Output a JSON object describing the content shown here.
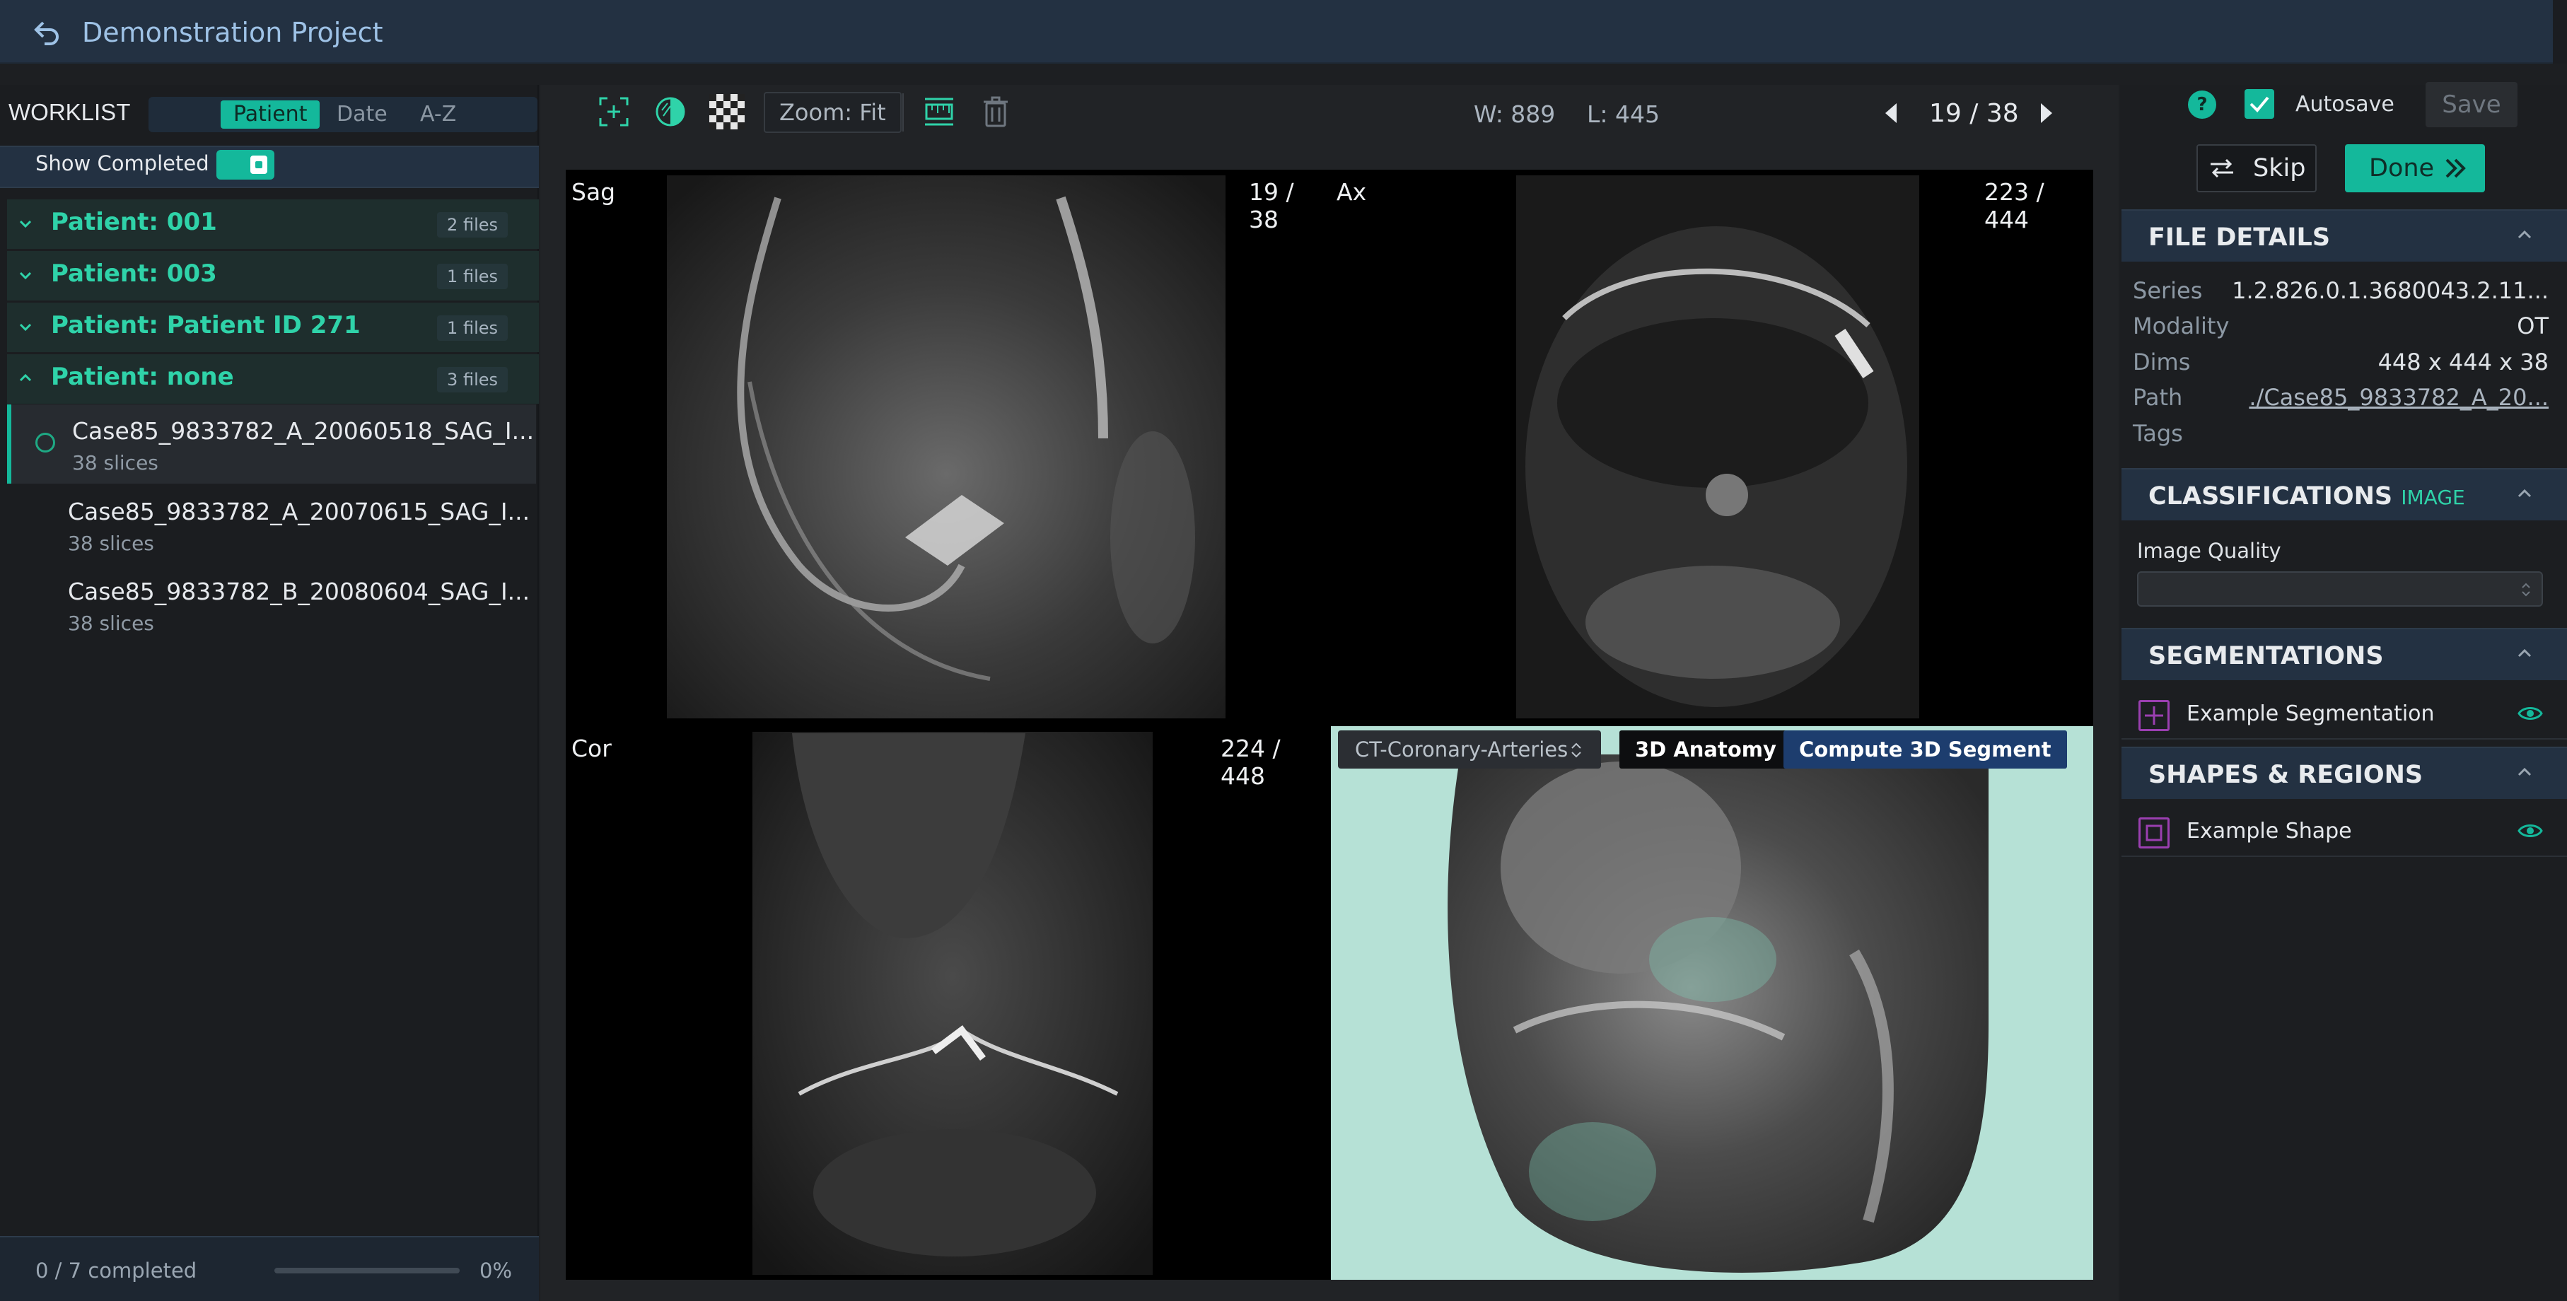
{
  "header": {
    "title": "Demonstration Project",
    "back_icon": "back-arrow-icon"
  },
  "worklist": {
    "title": "WORKLIST",
    "sort_options": [
      "Patient",
      "Date",
      "A-Z"
    ],
    "active_sort": "Patient",
    "show_completed_label": "Show Completed",
    "show_completed": true,
    "patients": [
      {
        "name": "Patient: 001",
        "count": "2 files",
        "expanded": false
      },
      {
        "name": "Patient: 003",
        "count": "1 files",
        "expanded": false
      },
      {
        "name": "Patient: Patient ID 271",
        "count": "1 files",
        "expanded": false
      },
      {
        "name": "Patient: none",
        "count": "3 files",
        "expanded": true
      }
    ],
    "files": [
      {
        "name": "Case85_9833782_A_20060518_SAG_I...",
        "slices": "38 slices",
        "selected": true
      },
      {
        "name": "Case85_9833782_A_20070615_SAG_I...",
        "slices": "38 slices",
        "selected": false
      },
      {
        "name": "Case85_9833782_B_20080604_SAG_I...",
        "slices": "38 slices",
        "selected": false
      }
    ],
    "progress_text": "0 / 7 completed",
    "progress_percent": "0%",
    "progress_value": 0
  },
  "toolbar": {
    "zoom_label": "Zoom: Fit",
    "window_width": "W: 889",
    "window_level": "L: 445",
    "slice_counter": "19 / 38"
  },
  "viewports": {
    "sag": {
      "label": "Sag",
      "counter": "19 / 38"
    },
    "ax": {
      "label": "Ax",
      "counter": "223 / 444"
    },
    "cor": {
      "label": "Cor",
      "counter": "224 / 448"
    },
    "three_d": {
      "preset": "CT-Coronary-Arteries",
      "anatomy_button": "3D Anatomy",
      "compute_button": "Compute 3D Segment",
      "background_color": "#b6e1d6"
    }
  },
  "actions": {
    "autosave_label": "Autosave",
    "autosave_checked": true,
    "save_label": "Save",
    "skip_label": "Skip",
    "done_label": "Done",
    "help_label": "?"
  },
  "file_details": {
    "title": "FILE DETAILS",
    "series_key": "Series",
    "series_value": "1.2.826.0.1.3680043.2.11...",
    "modality_key": "Modality",
    "modality_value": "OT",
    "dims_key": "Dims",
    "dims_value": "448 x 444 x 38",
    "path_key": "Path",
    "path_value": "./Case85_9833782_A_20...",
    "tags_key": "Tags"
  },
  "classifications": {
    "title": "CLASSIFICATIONS",
    "subtitle": "IMAGE",
    "image_quality_label": "Image Quality",
    "image_quality_value": ""
  },
  "segmentations": {
    "title": "SEGMENTATIONS",
    "items": [
      {
        "label": "Example Segmentation",
        "color": "#9a3fb0"
      }
    ]
  },
  "shapes": {
    "title": "SHAPES & REGIONS",
    "items": [
      {
        "label": "Example Shape",
        "color": "#9a3fb0"
      }
    ]
  },
  "colors": {
    "accent": "#14b89b",
    "patient_text": "#2fd3a9",
    "header_bg": "#233142"
  }
}
